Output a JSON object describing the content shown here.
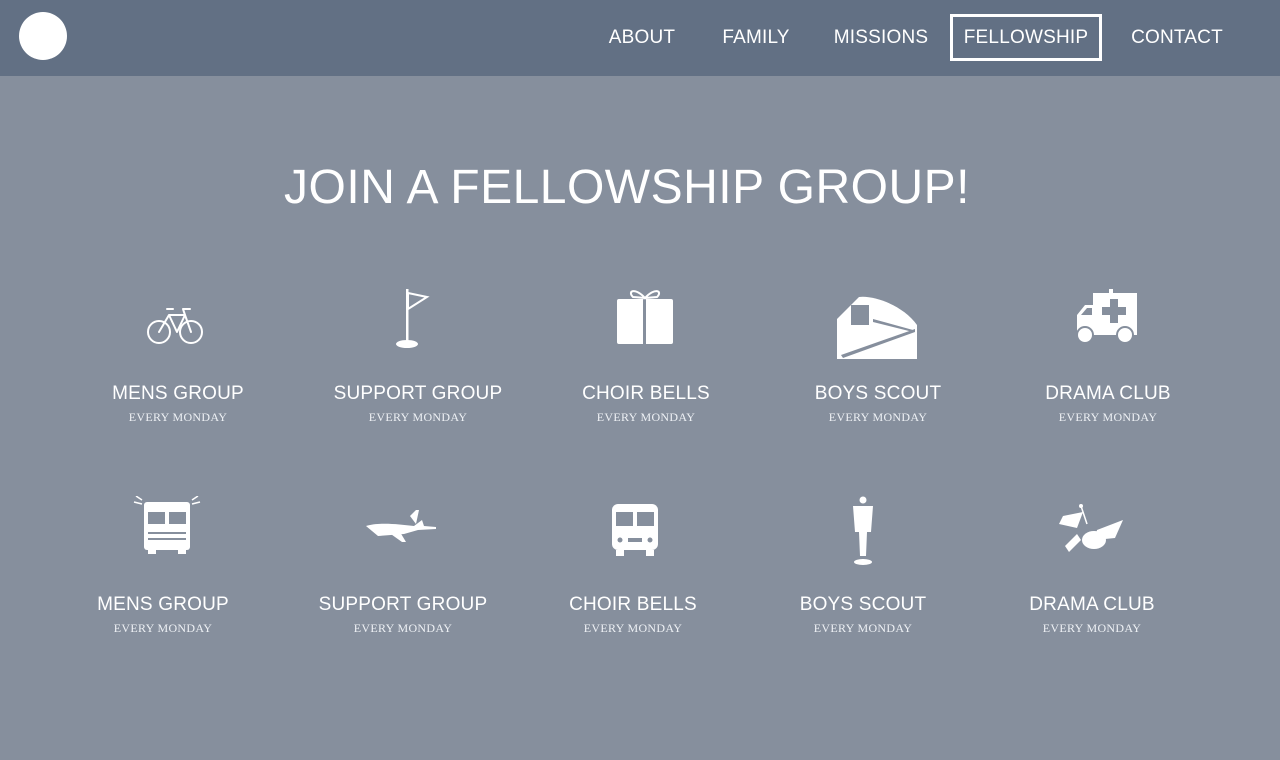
{
  "nav": {
    "items": [
      {
        "label": "ABOUT"
      },
      {
        "label": "FAMILY"
      },
      {
        "label": "MISSIONS"
      },
      {
        "label": "FELLOWSHIP",
        "active": true
      },
      {
        "label": "CONTACT"
      }
    ]
  },
  "main": {
    "title": "JOIN A FELLOWSHIP GROUP!",
    "groups": [
      {
        "name": "MENS GROUP",
        "schedule": "EVERY MONDAY",
        "icon": "bicycle-icon"
      },
      {
        "name": "SUPPORT GROUP",
        "schedule": "EVERY MONDAY",
        "icon": "golf-flag-icon"
      },
      {
        "name": "CHOIR BELLS",
        "schedule": "EVERY MONDAY",
        "icon": "gift-box-icon"
      },
      {
        "name": "BOYS SCOUT",
        "schedule": "EVERY MONDAY",
        "icon": "train-icon"
      },
      {
        "name": "DRAMA CLUB",
        "schedule": "EVERY MONDAY",
        "icon": "ambulance-icon"
      },
      {
        "name": "MENS GROUP",
        "schedule": "EVERY MONDAY",
        "icon": "fire-truck-icon"
      },
      {
        "name": "SUPPORT GROUP",
        "schedule": "EVERY MONDAY",
        "icon": "airplane-icon"
      },
      {
        "name": "CHOIR BELLS",
        "schedule": "EVERY MONDAY",
        "icon": "bus-icon"
      },
      {
        "name": "BOYS SCOUT",
        "schedule": "EVERY MONDAY",
        "icon": "man-in-suit-icon"
      },
      {
        "name": "DRAMA CLUB",
        "schedule": "EVERY MONDAY",
        "icon": "satellite-icon"
      }
    ]
  },
  "colors": {
    "background": "#868f9d",
    "navbar": "#627084",
    "foreground": "#ffffff"
  }
}
